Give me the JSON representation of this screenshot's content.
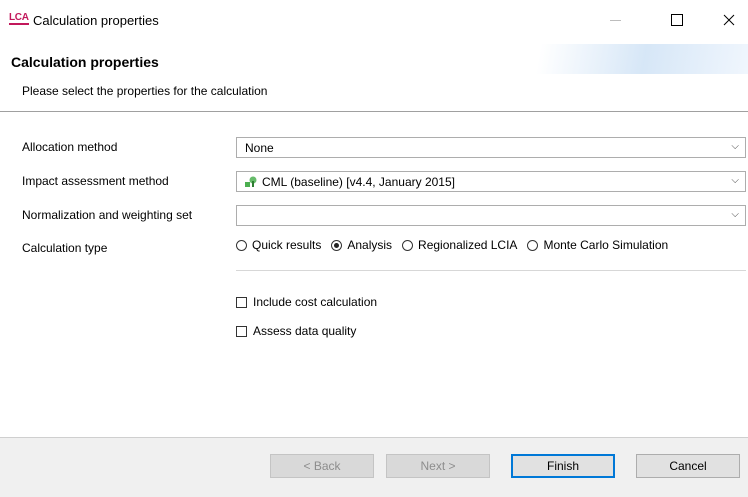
{
  "window": {
    "app_icon_text": "LCA",
    "title": "Calculation properties"
  },
  "header": {
    "title": "Calculation properties",
    "subtitle": "Please select the properties for the calculation"
  },
  "form": {
    "allocation": {
      "label": "Allocation method",
      "value": "None"
    },
    "impact": {
      "label": "Impact assessment method",
      "value": "CML (baseline) [v4.4, January 2015]",
      "icon": "impact-method-icon"
    },
    "normalization": {
      "label": "Normalization and weighting set",
      "value": ""
    },
    "calc_type": {
      "label": "Calculation type",
      "options": [
        {
          "label": "Quick results",
          "selected": false
        },
        {
          "label": "Analysis",
          "selected": true
        },
        {
          "label": "Regionalized LCIA",
          "selected": false
        },
        {
          "label": "Monte Carlo Simulation",
          "selected": false
        }
      ]
    },
    "include_cost": {
      "label": "Include cost calculation",
      "checked": false
    },
    "assess_quality": {
      "label": "Assess data quality",
      "checked": false
    }
  },
  "buttons": {
    "back": "< Back",
    "next": "Next >",
    "finish": "Finish",
    "cancel": "Cancel"
  },
  "colors": {
    "accent": "#0078d7",
    "app_icon": "#c2185b",
    "icon_green": "#4caf50"
  }
}
